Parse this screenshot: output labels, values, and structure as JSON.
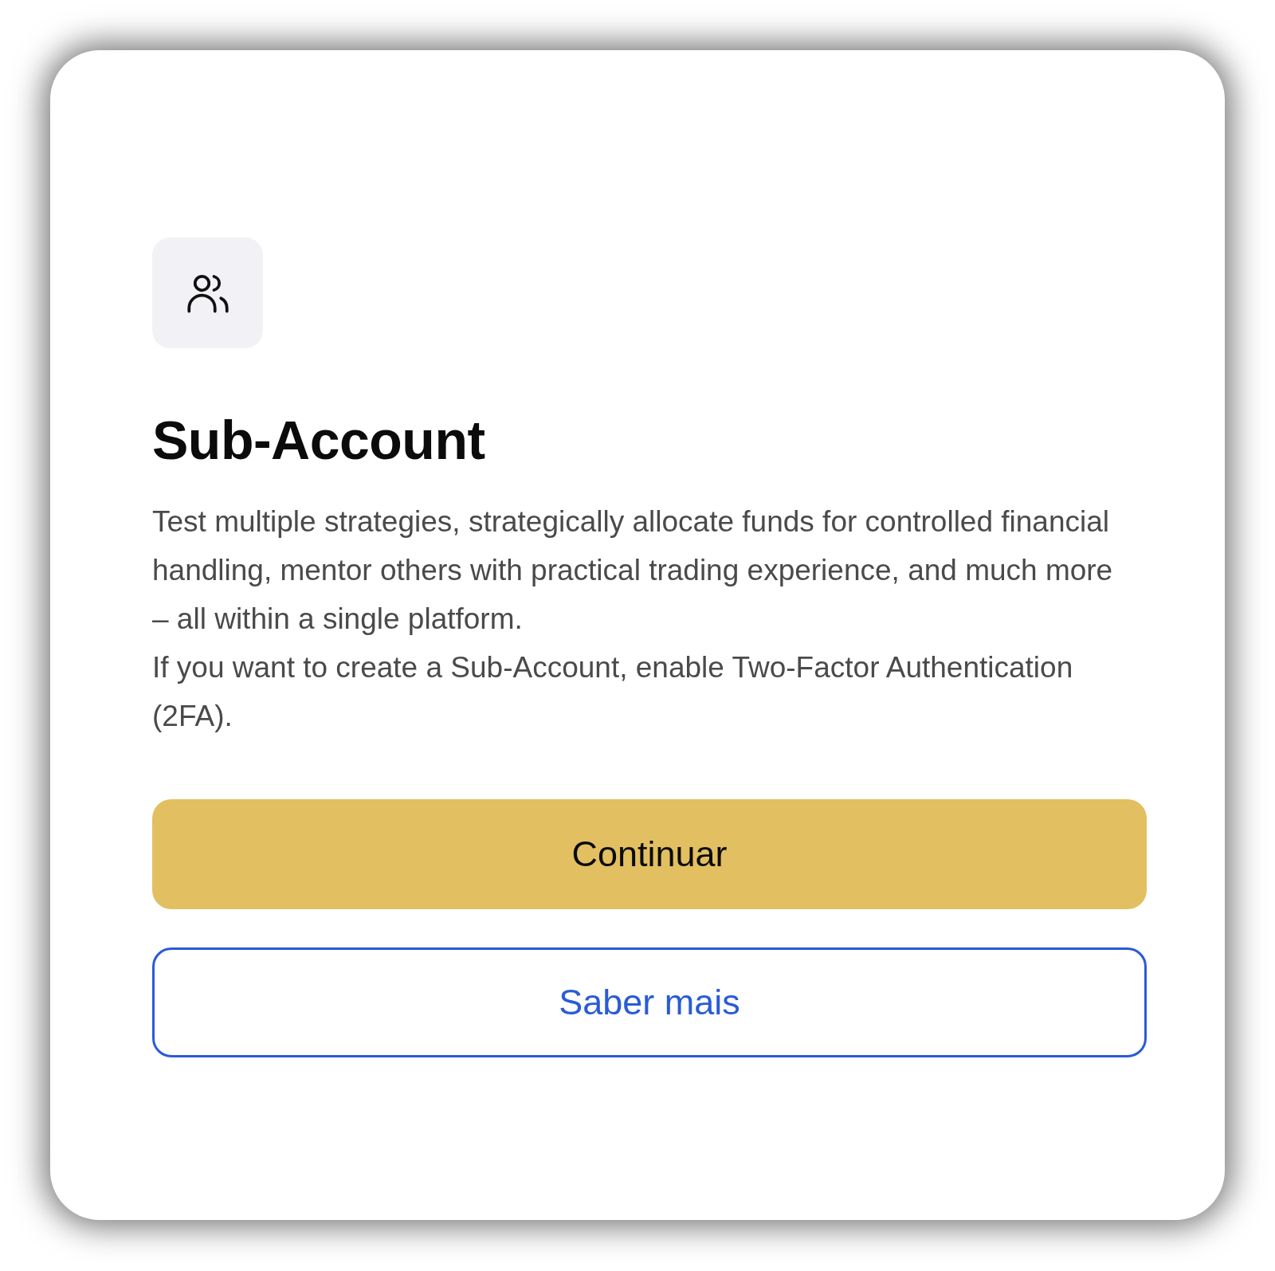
{
  "card": {
    "title": "Sub-Account",
    "paragraphs": [
      "Test multiple strategies, strategically allocate funds for controlled financial handling, mentor others with practical trading experience, and much more – all within a single platform.",
      "If you want to create a Sub-Account, enable Two-Factor Authentication (2FA)."
    ],
    "buttons": [
      {
        "label": "Continuar",
        "kind": "primary"
      },
      {
        "label": "Saber mais",
        "kind": "outline"
      }
    ]
  }
}
